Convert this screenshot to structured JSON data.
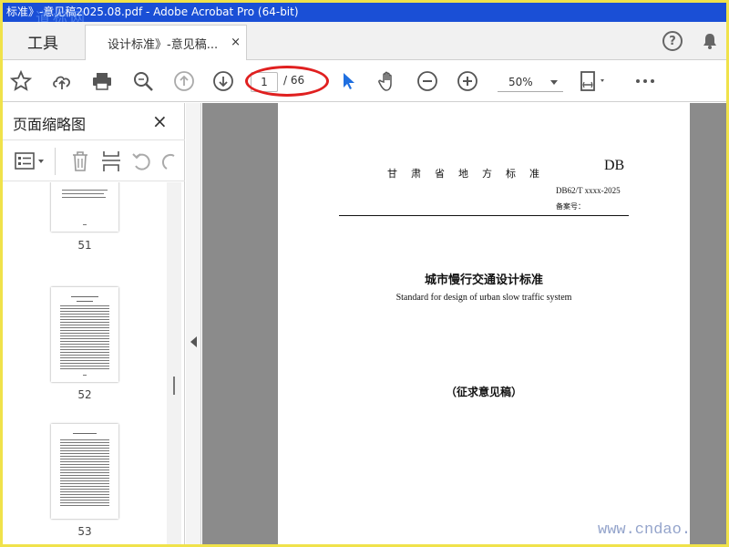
{
  "window": {
    "title": "标准》-意见稿2025.08.pdf - Adobe Acrobat Pro (64-bit)"
  },
  "watermarks": {
    "top": "道标网",
    "bottom": "www.cndao."
  },
  "tabs": {
    "tools": "工具",
    "document": "设计标准》-意见稿...",
    "close": "×"
  },
  "toolbar": {
    "current_page": "1",
    "total_pages": "/ 66",
    "zoom": "50%"
  },
  "sidepanel": {
    "title": "页面缩略图",
    "close": "×",
    "thumbnails": [
      {
        "label": "51"
      },
      {
        "label": "52"
      },
      {
        "label": "53"
      }
    ]
  },
  "document": {
    "org": "甘肃省地方标准",
    "db": "DB",
    "code": "DB62/T xxxx-2025",
    "record": "备案号：",
    "title_cn": "城市慢行交通设计标准",
    "title_en": "Standard for design of urban slow traffic system",
    "draft": "（征求意见稿）"
  },
  "icons": {
    "help": "?",
    "bell": "bell-icon"
  }
}
